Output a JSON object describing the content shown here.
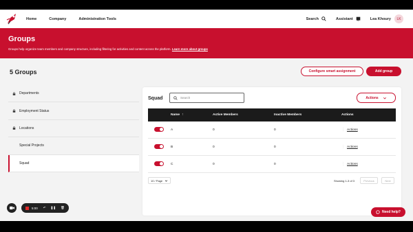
{
  "nav": {
    "items": [
      "Home",
      "Company",
      "Administration Tools"
    ]
  },
  "topright": {
    "search": "Search",
    "assistant": "Assistant",
    "user_name": "Lea Khoury",
    "user_initials": "LK"
  },
  "hero": {
    "title": "Groups",
    "description": "Groups help organize team members and company structure, including filtering for activities and content across the platform.",
    "link": "Learn more about groups"
  },
  "groups": {
    "count_title": "5 Groups",
    "configure_label": "Configure smart assignment",
    "add_label": "Add group"
  },
  "sidebar": {
    "items": [
      {
        "label": "Departments",
        "locked": true
      },
      {
        "label": "Employment Status",
        "locked": true
      },
      {
        "label": "Locations",
        "locked": true
      },
      {
        "label": "Special Projects",
        "locked": false
      },
      {
        "label": "Squad",
        "locked": false,
        "active": true
      }
    ]
  },
  "panel": {
    "title": "Squad",
    "search_placeholder": "Search",
    "actions_label": "Actions",
    "columns": [
      "Name",
      "Active Members",
      "Inactive Members",
      "Actions"
    ],
    "rows": [
      {
        "name": "A",
        "active": "0",
        "inactive": "0",
        "action": "Actions"
      },
      {
        "name": "B",
        "active": "0",
        "inactive": "0",
        "action": "Actions"
      },
      {
        "name": "C",
        "active": "0",
        "inactive": "0",
        "action": "Actions"
      }
    ],
    "per_page": "10 / Page",
    "showing": "Showing 1-3 of 3",
    "previous": "Previous",
    "next": "Next"
  },
  "recorder": {
    "time": "5:00"
  },
  "help": {
    "label": "Need help?"
  },
  "colors": {
    "brand": "#c8102e",
    "header_dark": "#1b1b1b"
  }
}
